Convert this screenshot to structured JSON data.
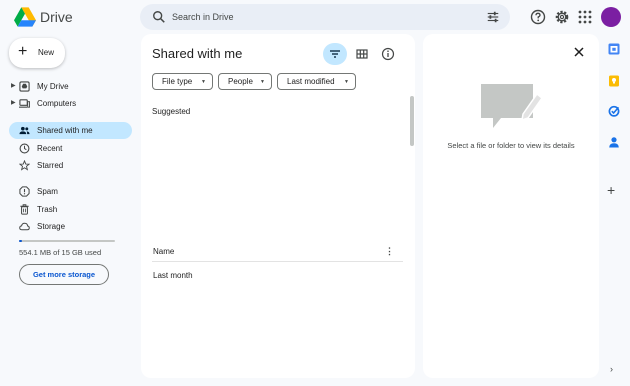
{
  "app": {
    "title": "Drive"
  },
  "search": {
    "placeholder": "Search in Drive"
  },
  "icons": {
    "logo": "drive-logo",
    "search": "search-icon",
    "tune": "tune-icon",
    "help": "help-icon",
    "settings": "gear-icon",
    "apps": "apps-grid-icon",
    "filter": "filter-icon",
    "grid": "grid-view-icon",
    "info": "info-icon",
    "close": "close-icon"
  },
  "colors": {
    "accent": "#0b57d0",
    "active_nav": "#c2e7ff",
    "avatar": "#7b1fa2",
    "page_bg": "#f7f9fc"
  },
  "sidebar": {
    "new_label": "New",
    "items": [
      {
        "label": "My Drive",
        "icon": "my-drive-icon"
      },
      {
        "label": "Computers",
        "icon": "computer-icon"
      },
      {
        "label": "Shared with me",
        "icon": "people-icon",
        "active": true
      },
      {
        "label": "Recent",
        "icon": "clock-icon"
      },
      {
        "label": "Starred",
        "icon": "star-icon"
      },
      {
        "label": "Spam",
        "icon": "spam-icon"
      },
      {
        "label": "Trash",
        "icon": "trash-icon"
      },
      {
        "label": "Storage",
        "icon": "cloud-icon"
      }
    ],
    "storage": {
      "used_text": "554.1 MB of 15 GB used",
      "used_fraction": 0.036,
      "button_label": "Get more storage"
    }
  },
  "main": {
    "title": "Shared with me",
    "filters": [
      "File type",
      "People",
      "Last modified"
    ],
    "suggested_label": "Suggested",
    "column_name": "Name",
    "group_label": "Last month"
  },
  "details": {
    "empty_text": "Select a file or folder to view its details"
  },
  "rail": {
    "apps": [
      "calendar-icon",
      "keep-icon",
      "tasks-icon",
      "contacts-icon"
    ],
    "add_label": "+",
    "chevron": "›"
  }
}
